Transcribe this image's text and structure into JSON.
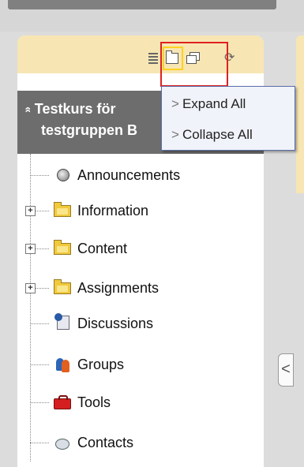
{
  "toolbar": {
    "icons": [
      "list-view-icon",
      "folder-view-icon",
      "windows-view-icon",
      "refresh-icon"
    ]
  },
  "course": {
    "title_line1": "Testkurs för",
    "title_line2": "testgruppen B",
    "collapse_glyph": "»"
  },
  "tree": {
    "items": [
      {
        "label": "Announcements",
        "icon": "speaker-icon",
        "expandable": false
      },
      {
        "label": "Information",
        "icon": "folder-icon",
        "expandable": true
      },
      {
        "label": "Content",
        "icon": "folder-icon",
        "expandable": true
      },
      {
        "label": "Assignments",
        "icon": "folder-icon",
        "expandable": true
      },
      {
        "label": "Discussions",
        "icon": "discussion-icon",
        "expandable": false
      },
      {
        "label": "Groups",
        "icon": "groups-icon",
        "expandable": false
      },
      {
        "label": "Tools",
        "icon": "toolbox-icon",
        "expandable": false
      },
      {
        "label": "Contacts",
        "icon": "contacts-icon",
        "expandable": false
      }
    ]
  },
  "dropdown": {
    "expand_all": "Expand All",
    "collapse_all": "Collapse All",
    "chevron": ">"
  },
  "handle": {
    "glyph": "<"
  },
  "colors": {
    "header_bg": "#f7e6b3",
    "course_bg": "#6d6d6d",
    "highlight_red": "#e02020",
    "highlight_yellow": "#ffd21f"
  }
}
